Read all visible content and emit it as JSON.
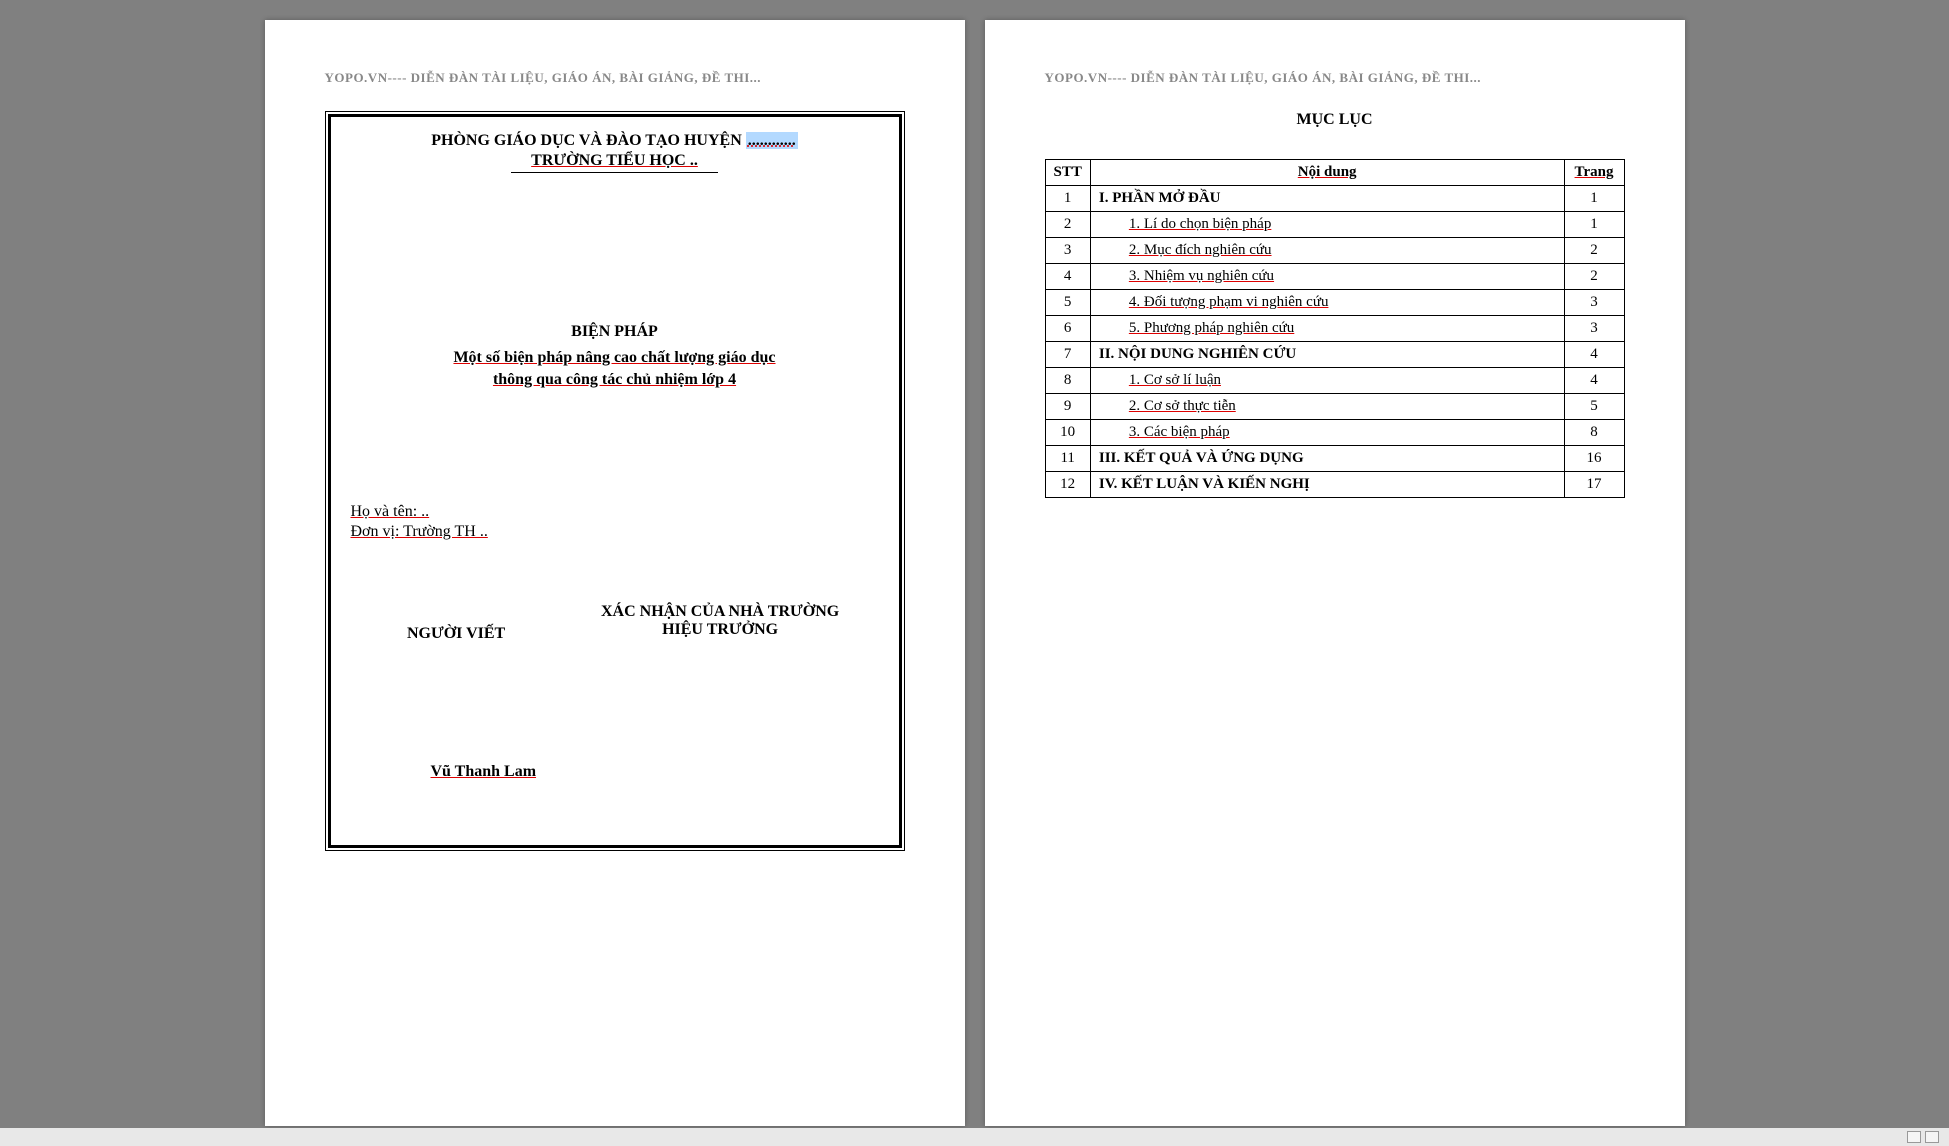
{
  "watermark": "YOPO.VN---- DIỄN ĐÀN TÀI LIỆU, GIÁO ÁN, BÀI GIẢNG, ĐỀ THI...",
  "page1": {
    "dept_prefix": "PHÒNG GIÁO DỤC VÀ ĐÀO TẠO HUYỆN ",
    "dept_blank": "............",
    "school_line": "TRƯỜNG TIỂU HỌC ..",
    "heading": "BIỆN PHÁP",
    "subtitle1": "Một số biện pháp nâng cao chất lượng giáo dục",
    "subtitle2": "thông qua công tác chủ nhiệm lớp 4",
    "name_label": "Họ và tên: ..",
    "unit_label": "Đơn vị: Trường TH ..",
    "sig_left": "NGƯỜI VIẾT",
    "sig_right_line1": "XÁC NHẬN CỦA NHÀ TRƯỜNG",
    "sig_right_line2": "HIỆU TRƯỞNG",
    "author": "Vũ Thanh Lam"
  },
  "page2": {
    "title": "MỤC LỤC",
    "headers": {
      "stt": "STT",
      "content": "Nội dung",
      "page": "Trang"
    },
    "rows": [
      {
        "stt": "1",
        "text": "I. PHẦN MỞ ĐẦU",
        "page": "1",
        "bold": true,
        "indent": false
      },
      {
        "stt": "2",
        "text": "1.  Lí do chọn biện pháp",
        "page": "1",
        "bold": false,
        "indent": true
      },
      {
        "stt": "3",
        "text": "2.   Mục đích nghiên cứu",
        "page": "2",
        "bold": false,
        "indent": true
      },
      {
        "stt": "4",
        "text": "3.   Nhiệm vụ nghiên cứu",
        "page": "2",
        "bold": false,
        "indent": true
      },
      {
        "stt": "5",
        "text": "4.  Đối tượng phạm vi nghiên cứu",
        "page": "3",
        "bold": false,
        "indent": true
      },
      {
        "stt": "6",
        "text": "5.  Phương pháp nghiên cứu",
        "page": "3",
        "bold": false,
        "indent": true
      },
      {
        "stt": "7",
        "text": "II. NỘI DUNG NGHIÊN CỨU",
        "page": "4",
        "bold": true,
        "indent": false
      },
      {
        "stt": "8",
        "text": "1.   Cơ sở lí luận",
        "page": "4",
        "bold": false,
        "indent": true
      },
      {
        "stt": "9",
        "text": "2.  Cơ sở thực tiễn",
        "page": "5",
        "bold": false,
        "indent": true
      },
      {
        "stt": "10",
        "text": "3.  Các biện pháp",
        "page": "8",
        "bold": false,
        "indent": true
      },
      {
        "stt": "11",
        "text": "III. KẾT QUẢ VÀ ỨNG DỤNG",
        "page": "16",
        "bold": true,
        "indent": false
      },
      {
        "stt": "12",
        "text": "IV. KẾT LUẬN VÀ KIẾN NGHỊ",
        "page": "17",
        "bold": true,
        "indent": false
      }
    ]
  }
}
